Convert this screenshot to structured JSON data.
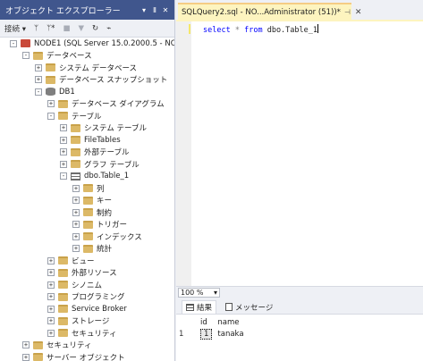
{
  "object_explorer": {
    "title": "オブジェクト エクスプローラー",
    "title_buttons": [
      "▾",
      "Ⅱ",
      "✕"
    ],
    "toolbar": {
      "connect_label": "接続 ▾",
      "buttons": [
        {
          "name": "connect-plug-icon",
          "glyph": "ᛘ"
        },
        {
          "name": "disconnect-icon",
          "glyph": "ᛘ*"
        },
        {
          "name": "stop-icon",
          "glyph": "■"
        },
        {
          "name": "filter-icon",
          "glyph": "▼"
        },
        {
          "name": "refresh-icon",
          "glyph": "↻"
        },
        {
          "name": "activity-monitor-icon",
          "glyph": "⌁"
        }
      ]
    },
    "tree": [
      {
        "indent": 0,
        "expander": "-",
        "icon": "server",
        "label": "NODE1 (SQL Server 15.0.2000.5 - NODE"
      },
      {
        "indent": 1,
        "expander": "-",
        "icon": "folder",
        "label": "データベース"
      },
      {
        "indent": 2,
        "expander": "+",
        "icon": "folder",
        "label": "システム データベース"
      },
      {
        "indent": 2,
        "expander": "+",
        "icon": "folder",
        "label": "データベース スナップショット"
      },
      {
        "indent": 2,
        "expander": "-",
        "icon": "db",
        "label": "DB1"
      },
      {
        "indent": 3,
        "expander": "+",
        "icon": "folder",
        "label": "データベース ダイアグラム"
      },
      {
        "indent": 3,
        "expander": "-",
        "icon": "folder",
        "label": "テーブル"
      },
      {
        "indent": 4,
        "expander": "+",
        "icon": "folder",
        "label": "システム テーブル"
      },
      {
        "indent": 4,
        "expander": "+",
        "icon": "folder",
        "label": "FileTables"
      },
      {
        "indent": 4,
        "expander": "+",
        "icon": "folder",
        "label": "外部テーブル"
      },
      {
        "indent": 4,
        "expander": "+",
        "icon": "folder",
        "label": "グラフ テーブル"
      },
      {
        "indent": 4,
        "expander": "-",
        "icon": "table",
        "label": "dbo.Table_1"
      },
      {
        "indent": 5,
        "expander": "+",
        "icon": "folder",
        "label": "列"
      },
      {
        "indent": 5,
        "expander": "+",
        "icon": "folder",
        "label": "キー"
      },
      {
        "indent": 5,
        "expander": "+",
        "icon": "folder",
        "label": "制約"
      },
      {
        "indent": 5,
        "expander": "+",
        "icon": "folder",
        "label": "トリガー"
      },
      {
        "indent": 5,
        "expander": "+",
        "icon": "folder",
        "label": "インデックス"
      },
      {
        "indent": 5,
        "expander": "+",
        "icon": "folder",
        "label": "統計"
      },
      {
        "indent": 3,
        "expander": "+",
        "icon": "folder",
        "label": "ビュー"
      },
      {
        "indent": 3,
        "expander": "+",
        "icon": "folder",
        "label": "外部リソース"
      },
      {
        "indent": 3,
        "expander": "+",
        "icon": "folder",
        "label": "シノニム"
      },
      {
        "indent": 3,
        "expander": "+",
        "icon": "folder",
        "label": "プログラミング"
      },
      {
        "indent": 3,
        "expander": "+",
        "icon": "folder",
        "label": "Service Broker"
      },
      {
        "indent": 3,
        "expander": "+",
        "icon": "folder",
        "label": "ストレージ"
      },
      {
        "indent": 3,
        "expander": "+",
        "icon": "folder",
        "label": "セキュリティ"
      },
      {
        "indent": 1,
        "expander": "+",
        "icon": "folder",
        "label": "セキュリティ"
      },
      {
        "indent": 1,
        "expander": "+",
        "icon": "folder",
        "label": "サーバー オブジェクト"
      }
    ]
  },
  "editor": {
    "tab_title": "SQLQuery2.sql - NO...Administrator (51))*",
    "tab_pin": "⊣",
    "tab_close": "✕",
    "code": {
      "kw1": "select",
      "star": "*",
      "kw2": "from",
      "ident": "dbo.Table_1"
    },
    "zoom": "100 %",
    "zoom_arrow": "▾"
  },
  "results": {
    "tabs": {
      "results": "結果",
      "messages": "メッセージ"
    },
    "columns": [
      "id",
      "name"
    ],
    "rows": [
      {
        "row_number": "1",
        "id": "1",
        "name": "tanaka"
      }
    ]
  },
  "colors": {
    "title_bar": "#40568d",
    "active_tab": "#fdf4bf",
    "keyword": "#0000ff",
    "folder": "#dcb967"
  }
}
